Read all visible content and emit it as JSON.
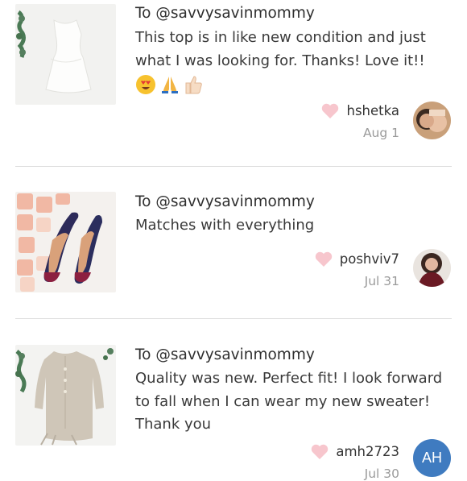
{
  "comments": [
    {
      "to": "To @savvysavinmommy",
      "message": "This top is in like new condition and just what I was looking for. Thanks! Love it!!",
      "emojis": [
        "heart-eyes-emoji",
        "folded-hands-emoji",
        "thumbs-up-emoji"
      ],
      "username": "hshetka",
      "date": "Aug 1"
    },
    {
      "to": "To @savvysavinmommy",
      "message": "Matches with everything",
      "username": "poshviv7",
      "date": "Jul 31"
    },
    {
      "to": "To @savvysavinmommy",
      "message": "Quality was new. Perfect fit! I look forward to fall when I can wear my new sweater! Thank you",
      "username": "amh2723",
      "date": "Jul 30",
      "avatar_initials": "AH"
    }
  ],
  "colors": {
    "heart": "#f7c6cd",
    "divider": "#dcdcdc",
    "date": "#9a9a9a",
    "avatar_bg": "#3f7bc0"
  }
}
